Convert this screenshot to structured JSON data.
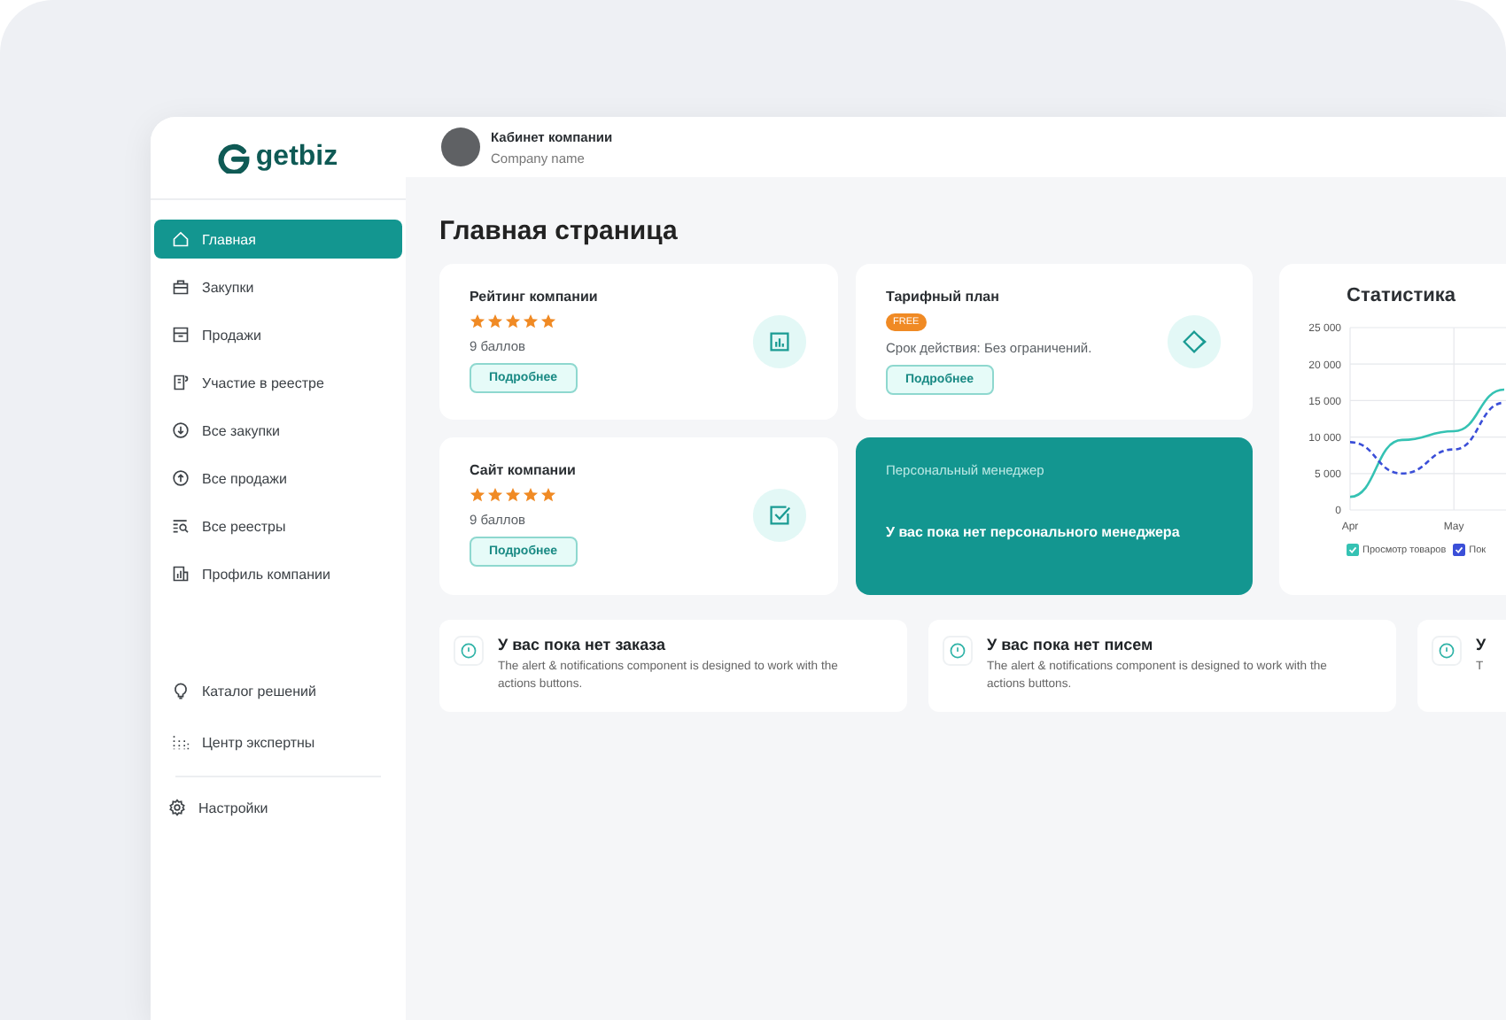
{
  "logo": {
    "text": "getbiz"
  },
  "sidebar": {
    "items": [
      {
        "label": "Главная",
        "selected": true
      },
      {
        "label": "Закупки",
        "selected": false
      },
      {
        "label": "Продажи",
        "selected": false
      },
      {
        "label": "Участие в реестре",
        "selected": false
      },
      {
        "label": "Все закупки",
        "selected": false
      },
      {
        "label": "Все продажи",
        "selected": false
      },
      {
        "label": "Все реестры",
        "selected": false
      },
      {
        "label": "Профиль компании",
        "selected": false
      }
    ],
    "extra_items": [
      {
        "label": "Каталог решений",
        "selected": false
      },
      {
        "label": "Центр экспертны",
        "selected": false
      }
    ],
    "settings_item": {
      "label": "Настройки",
      "selected": false
    }
  },
  "header": {
    "title": "Кабинет компании",
    "subtitle": "Company name"
  },
  "page_title": "Главная страница",
  "cards": [
    {
      "kind": "rating",
      "title": "Рейтинг компании",
      "stars": 5,
      "score": "9 баллов",
      "button": "Подробнее"
    },
    {
      "kind": "plan",
      "title": "Тарифный план",
      "badge": "FREE",
      "text": "Срок действия: Без ограничений.",
      "button": "Подробнее"
    },
    {
      "kind": "rating",
      "title": "Сайт компании",
      "stars": 5,
      "score": "9 баллов",
      "button": "Подробнее"
    },
    {
      "kind": "manager",
      "title": "Персональный менеджер",
      "text": "У вас пока нет персонального менеджера"
    }
  ],
  "statistics": {
    "chart_data": {
      "type": "line",
      "title": "Статистика",
      "grid": true,
      "categories": [
        "Apr",
        null,
        "May",
        null
      ],
      "ylim": [
        0,
        25000
      ],
      "yticks": [
        {
          "value": 0,
          "label": "0"
        },
        {
          "value": 5000,
          "label": "5 000"
        },
        {
          "value": 10000,
          "label": "10 000"
        },
        {
          "value": 15000,
          "label": "15 000"
        },
        {
          "value": 20000,
          "label": "20 000"
        },
        {
          "value": 25000,
          "label": "25 000"
        }
      ],
      "series": [
        {
          "name": "Просмотр товаров",
          "color": "#35c2b3",
          "line_style": "solid",
          "values": [
            1800,
            9600,
            10800,
            16500
          ]
        },
        {
          "name": "Пок",
          "color": "#3b4fd8",
          "line_style": "dashed",
          "values": [
            9300,
            5000,
            8300,
            14700
          ]
        }
      ]
    }
  },
  "alerts": [
    {
      "title": "У вас пока нет заказа",
      "text": "The alert & notifications component is designed to work with the actions buttons."
    },
    {
      "title": "У вас пока нет писем",
      "text": "The alert & notifications component is designed to work with the actions buttons."
    },
    {
      "title": "У",
      "text": "T"
    }
  ]
}
